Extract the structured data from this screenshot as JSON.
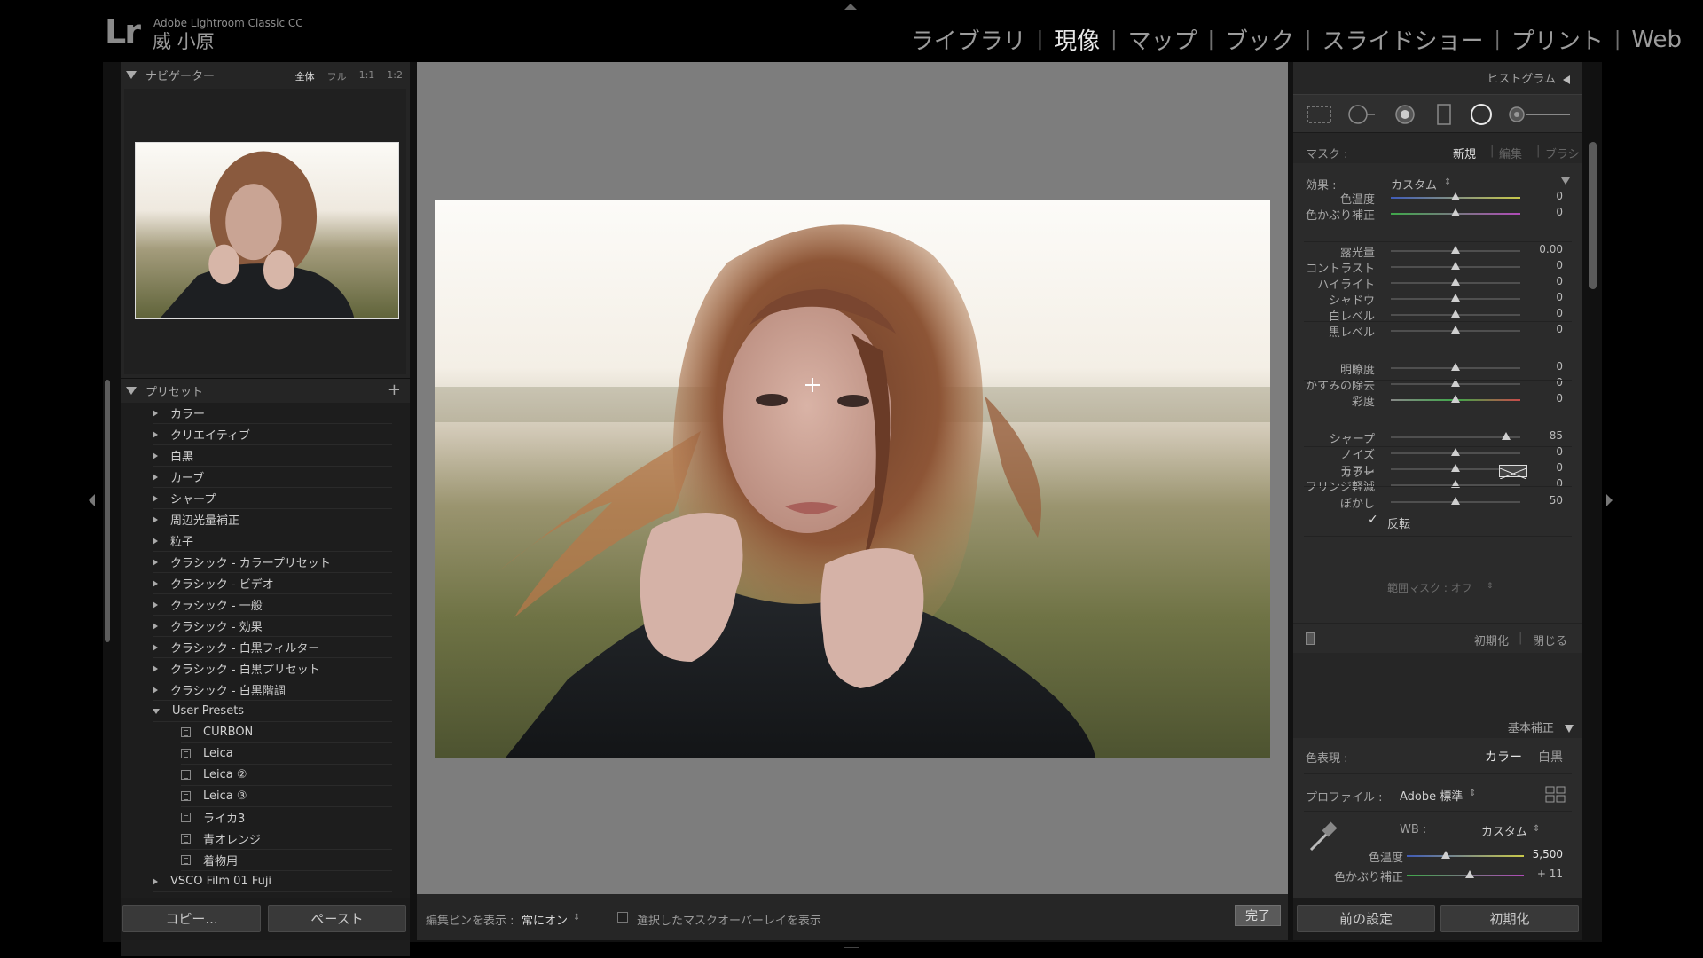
{
  "app": {
    "logo": "Lr",
    "name": "Adobe Lightroom Classic CC",
    "user": "威 小原"
  },
  "modules": [
    {
      "label": "ライブラリ",
      "active": false
    },
    {
      "label": "現像",
      "active": true
    },
    {
      "label": "マップ",
      "active": false
    },
    {
      "label": "ブック",
      "active": false
    },
    {
      "label": "スライドショー",
      "active": false
    },
    {
      "label": "プリント",
      "active": false
    },
    {
      "label": "Web",
      "active": false
    }
  ],
  "module_separator": "|",
  "navigator": {
    "title": "ナビゲーター",
    "zooms": [
      "全体",
      "フル",
      "1:1",
      "1:2"
    ],
    "active_zoom": "全体"
  },
  "presets": {
    "title": "プリセット",
    "add": "+",
    "groups": [
      "カラー",
      "クリエイティブ",
      "白黒",
      "カーブ",
      "シャープ",
      "周辺光量補正",
      "粒子",
      "クラシック - カラープリセット",
      "クラシック - ビデオ",
      "クラシック - 一般",
      "クラシック - 効果",
      "クラシック - 白黒フィルター",
      "クラシック - 白黒プリセット",
      "クラシック - 白黒階調"
    ],
    "open_group": "User Presets",
    "user_presets": [
      "CURBON",
      "Leica",
      "Leica ②",
      "Leica ③",
      "ライカ3",
      "青オレンジ",
      "着物用"
    ],
    "next_group": "VSCO Film 01 Fuji"
  },
  "left_buttons": {
    "copy": "コピー...",
    "paste": "ペースト"
  },
  "toolbar": {
    "pin_label": "編集ピンを表示 :",
    "pin_value": "常にオン",
    "pin_arrows": "⇕",
    "overlay_label": "選択したマスクオーバーレイを表示",
    "done": "完了"
  },
  "histogram": {
    "title": "ヒストグラム"
  },
  "mask": {
    "label": "マスク :",
    "new": "新規",
    "edit": "編集",
    "brush": "ブラシ"
  },
  "effect": {
    "label": "効果 :",
    "value": "カスタム",
    "arrows": "⇕"
  },
  "local_sliders": [
    {
      "label": "色温度",
      "value": "0",
      "pos": 0.5,
      "group": 0
    },
    {
      "label": "色かぶり補正",
      "value": "0",
      "pos": 0.5,
      "group": 0
    },
    {
      "label": "露光量",
      "value": "0.00",
      "pos": 0.5,
      "group": 1
    },
    {
      "label": "コントラスト",
      "value": "0",
      "pos": 0.5,
      "group": 1
    },
    {
      "label": "ハイライト",
      "value": "0",
      "pos": 0.5,
      "group": 1
    },
    {
      "label": "シャドウ",
      "value": "0",
      "pos": 0.5,
      "group": 1
    },
    {
      "label": "白レベル",
      "value": "0",
      "pos": 0.5,
      "group": 1
    },
    {
      "label": "黒レベル",
      "value": "0",
      "pos": 0.5,
      "group": 1
    },
    {
      "label": "明瞭度",
      "value": "0",
      "pos": 0.5,
      "group": 2
    },
    {
      "label": "かすみの除去",
      "value": "0",
      "pos": 0.5,
      "group": 2
    },
    {
      "label": "彩度",
      "value": "0",
      "pos": 0.5,
      "group": 2
    },
    {
      "label": "シャープ",
      "value": "85",
      "pos": 0.89,
      "group": 3
    },
    {
      "label": "ノイズ",
      "value": "0",
      "pos": 0.5,
      "group": 3
    },
    {
      "label": "モアレ",
      "value": "0",
      "pos": 0.5,
      "group": 3
    },
    {
      "label": "フリンジ軽減",
      "value": "0",
      "pos": 0.5,
      "group": 3
    }
  ],
  "color_row": {
    "label": "カラー"
  },
  "feather": {
    "label": "ぼかし",
    "value": "50",
    "pos": 0.5
  },
  "invert": {
    "label": "反転",
    "checked": true
  },
  "range_mask": {
    "label": "範囲マスク : オフ",
    "arrows": "⇕"
  },
  "mask_actions": {
    "reset": "初期化",
    "close": "閉じる"
  },
  "basic": {
    "title": "基本補正",
    "treatment_label": "色表現 :",
    "color": "カラー",
    "bw": "白黒",
    "profile_label": "プロファイル :",
    "profile_value": "Adobe 標準",
    "profile_arrows": "⇕",
    "wb_label": "WB :",
    "wb_value": "カスタム",
    "wb_arrows": "⇕",
    "temp_label": "色温度",
    "temp_value": "5,500",
    "temp_pos": 0.33,
    "tint_label": "色かぶり補正",
    "tint_value": "+ 11",
    "tint_pos": 0.54
  },
  "right_buttons": {
    "previous": "前の設定",
    "reset": "初期化"
  },
  "colors": {
    "accent_active": "#e8e8e8",
    "panel": "#262626",
    "canvas": "#7d7d7d"
  }
}
